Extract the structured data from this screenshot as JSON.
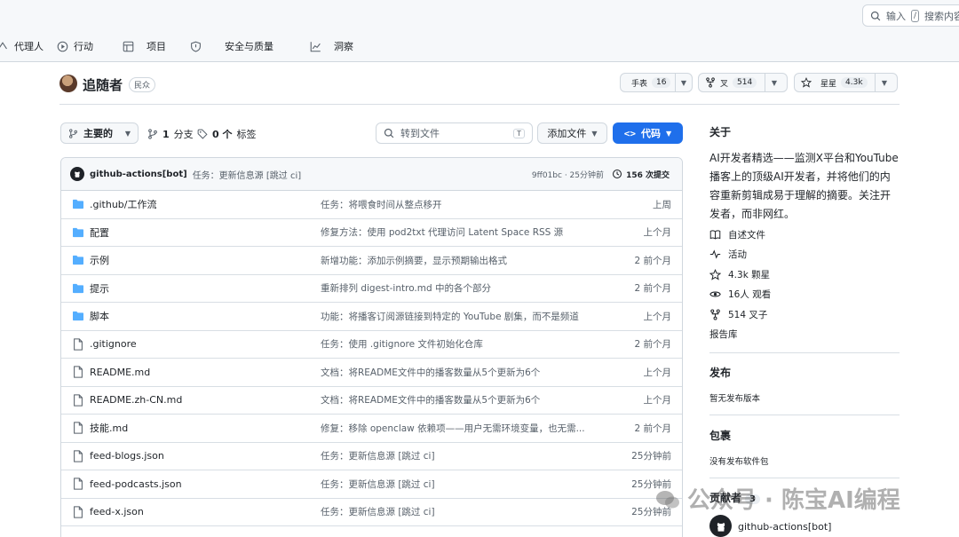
{
  "top": {
    "search_prefix": "输入",
    "search_key": "/",
    "search_suffix": "搜索内容"
  },
  "nav": [
    {
      "label": "代理人",
      "icon": "agent-icon"
    },
    {
      "label": "行动",
      "icon": "play-icon"
    },
    {
      "label": "项目",
      "icon": "table-icon"
    },
    {
      "label": "安全与质量",
      "icon": "shield-icon"
    },
    {
      "label": "洞察",
      "icon": "graph-icon"
    }
  ],
  "repo": {
    "name": "追随者",
    "visibility": "民众",
    "watch_label": "手表",
    "watch_count": "16",
    "fork_label": "叉",
    "fork_count": "514",
    "star_label": "星星",
    "star_count": "4.3k"
  },
  "toolbar": {
    "branch": "主要的",
    "branches_count": "1",
    "branches_label": "分支",
    "tags_count": "0 个",
    "tags_label": "标签",
    "goto_placeholder": "转到文件",
    "goto_key": "T",
    "add_file": "添加文件",
    "code": "代码"
  },
  "latest_commit": {
    "author": "github-actions[bot]",
    "message": "任务：更新信息源 [跳过 ci]",
    "meta": "9ff01bc · 25分钟前",
    "commits": "156 次提交"
  },
  "files": [
    {
      "type": "dir",
      "name": ".github/工作流",
      "message": "任务：将喂食时间从整点移开",
      "time": "上周"
    },
    {
      "type": "dir",
      "name": "配置",
      "message": "修复方法：使用 pod2txt 代理访问 Latent Space RSS 源",
      "time": "上个月"
    },
    {
      "type": "dir",
      "name": "示例",
      "message": "新增功能：添加示例摘要，显示预期输出格式",
      "time": "2 前个月"
    },
    {
      "type": "dir",
      "name": "提示",
      "message": "重新排列 digest-intro.md 中的各个部分",
      "time": "2 前个月"
    },
    {
      "type": "dir",
      "name": "脚本",
      "message": "功能：将播客订阅源链接到特定的 YouTube 剧集，而不是频道",
      "time": "上个月"
    },
    {
      "type": "file",
      "name": ".gitignore",
      "message": "任务：使用 .gitignore 文件初始化仓库",
      "time": "2 前个月"
    },
    {
      "type": "file",
      "name": "README.md",
      "message": "文档：将README文件中的播客数量从5个更新为6个",
      "time": "上个月"
    },
    {
      "type": "file",
      "name": "README.zh-CN.md",
      "message": "文档：将README文件中的播客数量从5个更新为6个",
      "time": "上个月"
    },
    {
      "type": "file",
      "name": "技能.md",
      "message": "修复：移除 openclaw 依赖项——用户无需环境变量，也无需...",
      "time": "2 前个月"
    },
    {
      "type": "file",
      "name": "feed-blogs.json",
      "message": "任务：更新信息源 [跳过 ci]",
      "time": "25分钟前"
    },
    {
      "type": "file",
      "name": "feed-podcasts.json",
      "message": "任务：更新信息源 [跳过 ci]",
      "time": "25分钟前"
    },
    {
      "type": "file",
      "name": "feed-x.json",
      "message": "任务：更新信息源 [跳过 ci]",
      "time": "25分钟前"
    }
  ],
  "sidebar": {
    "about_title": "关于",
    "description": "AI开发者精选——监测X平台和YouTube播客上的顶级AI开发者，并将他们的内容重新剪辑成易于理解的摘要。关注开发者，而非网红。",
    "links": [
      {
        "label": "自述文件",
        "icon": "book-icon"
      },
      {
        "label": "活动",
        "icon": "pulse-icon"
      },
      {
        "label": "4.3k 颗星",
        "icon": "star-icon"
      },
      {
        "label": "16人 观看",
        "icon": "eye-icon"
      },
      {
        "label": "514 叉子",
        "icon": "fork-icon"
      }
    ],
    "report": "报告库",
    "releases_title": "发布",
    "releases_empty": "暂无发布版本",
    "packages_title": "包裹",
    "packages_empty": "没有发布软件包",
    "contributors_title": "贡献者",
    "contributors_count": "3",
    "contributor_name": "github-actions[bot]"
  },
  "watermark": {
    "text": "公众号 · 陈宝AI编程"
  },
  "colors": {
    "accent": "#1f6feb",
    "folder": "#54aeff",
    "border": "#d0d7de",
    "muted": "#57606a"
  }
}
